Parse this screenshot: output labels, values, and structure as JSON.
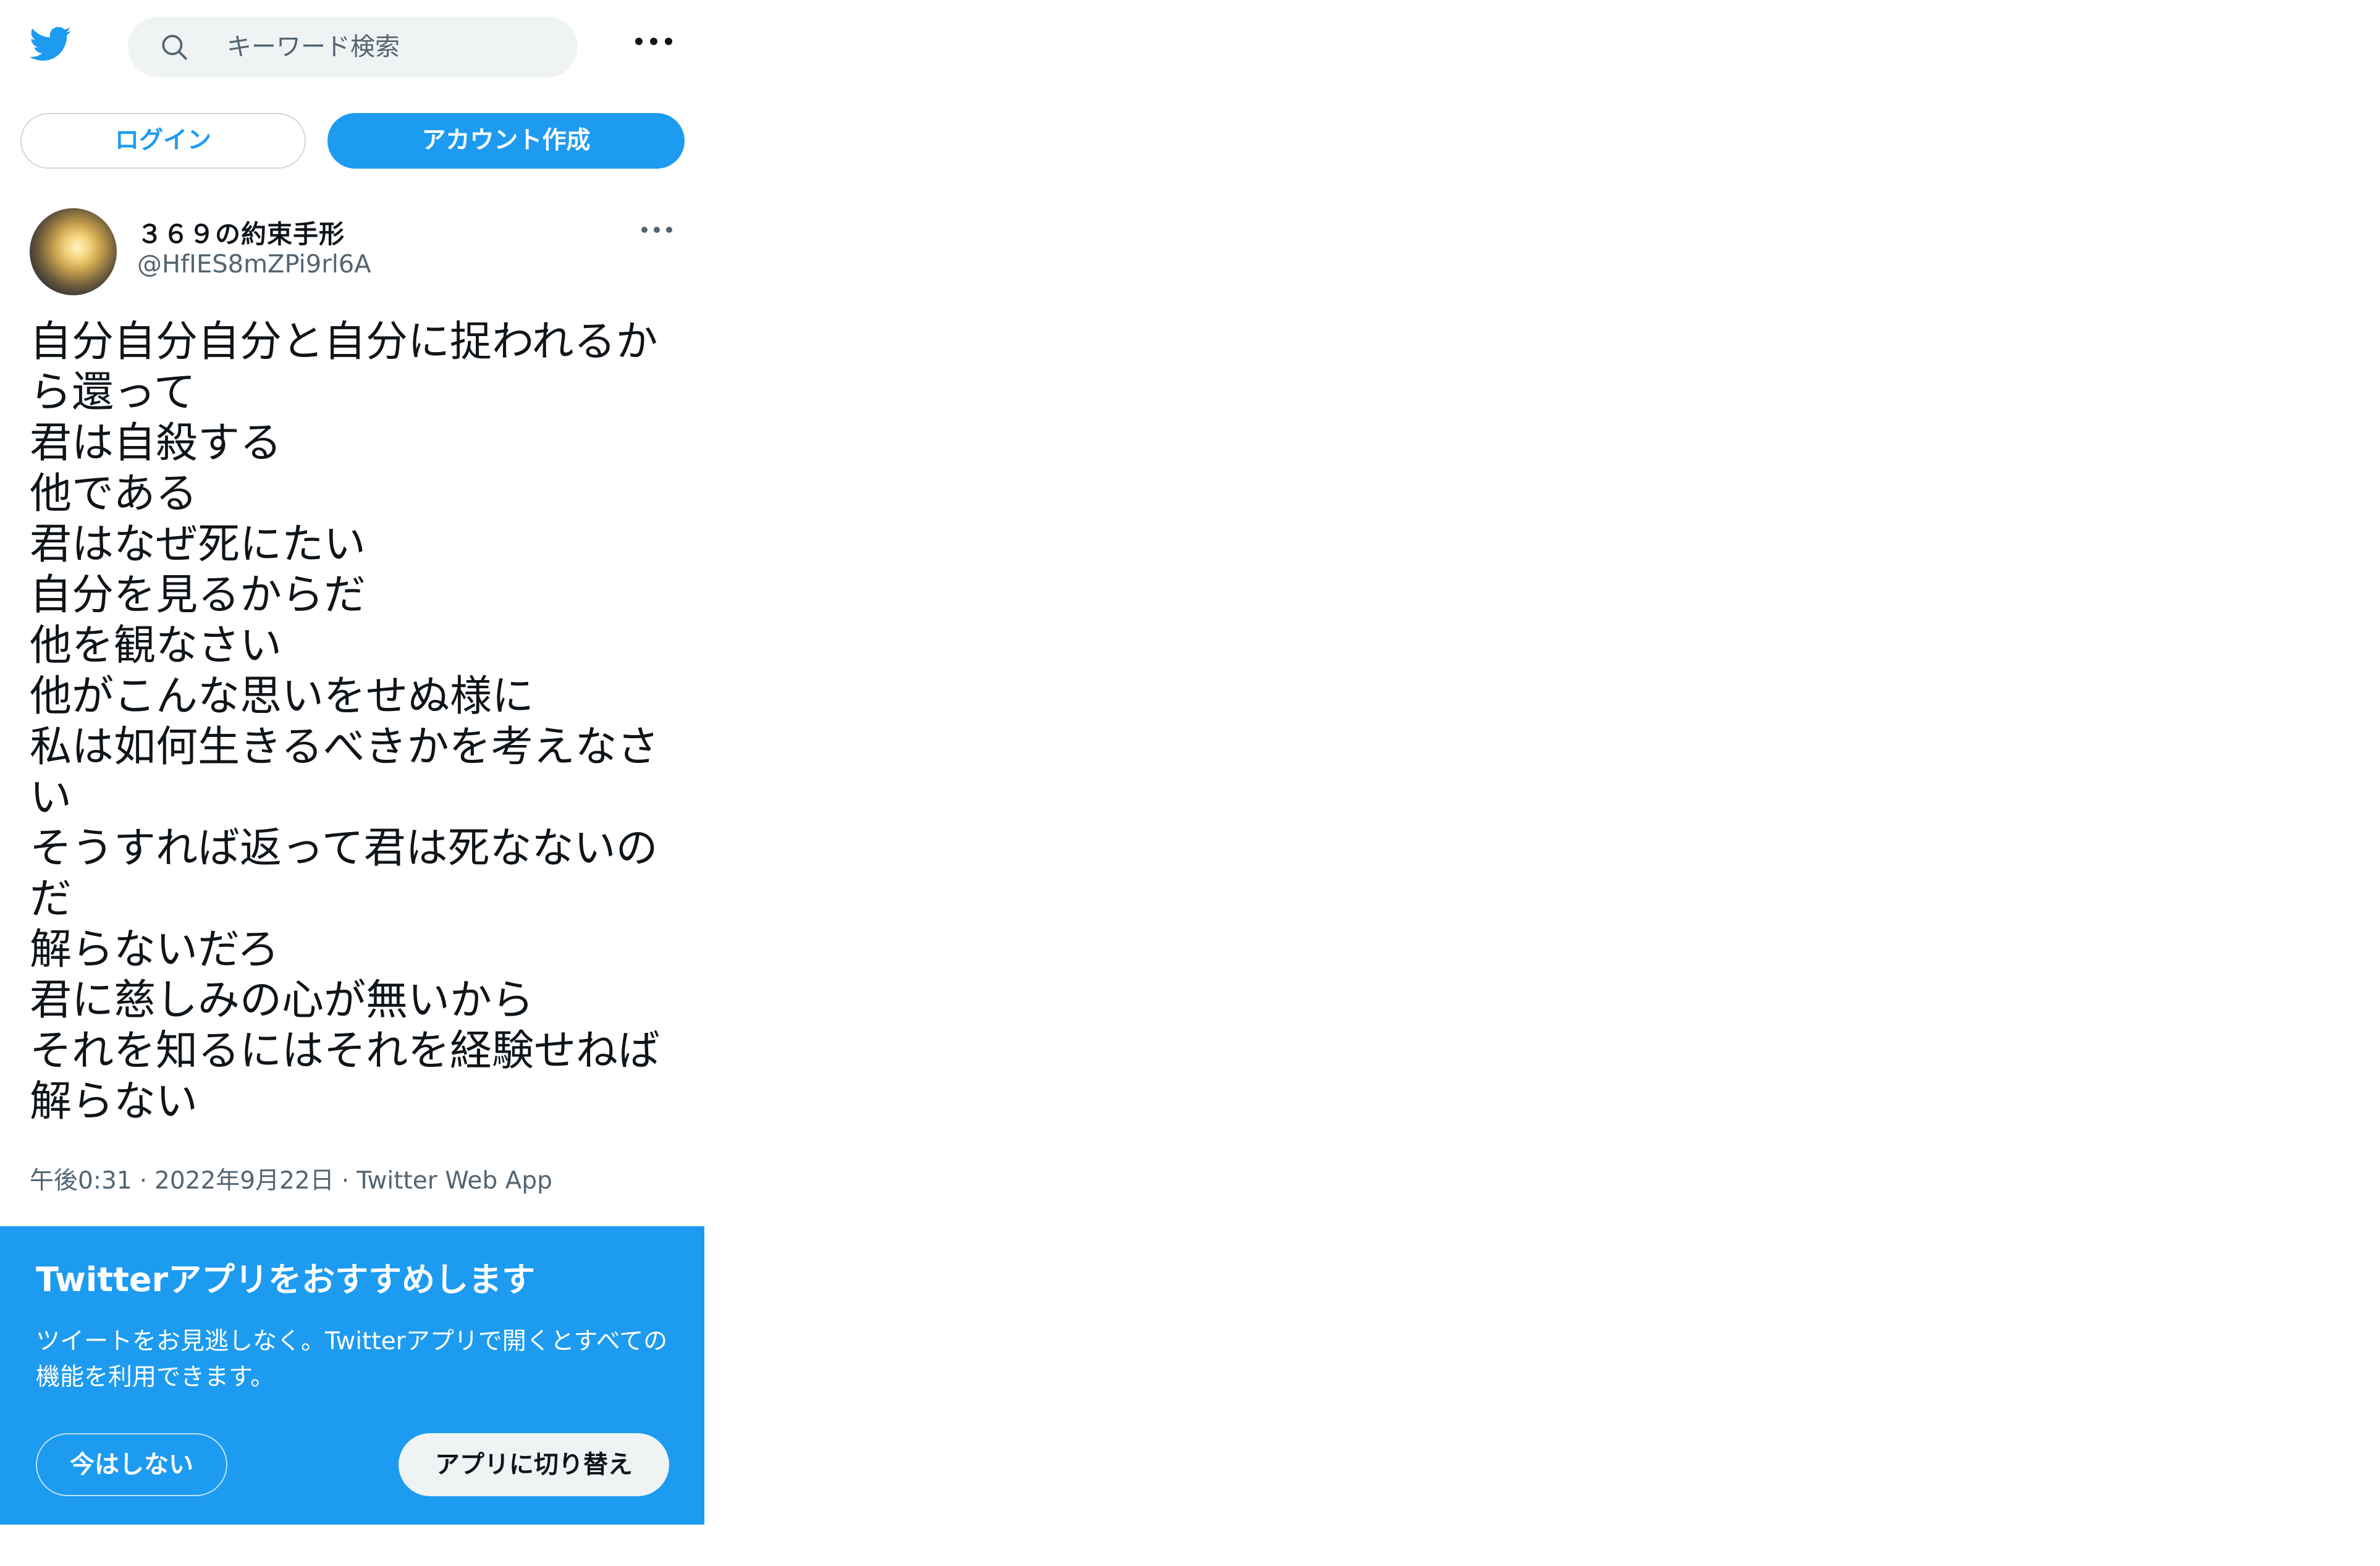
{
  "header": {
    "logo_icon": "twitter-bird-icon",
    "search": {
      "icon": "search-icon",
      "placeholder": "キーワード検索"
    },
    "more_icon": "more-horizontal-icon"
  },
  "auth": {
    "login_label": "ログイン",
    "signup_label": "アカウント作成"
  },
  "tweet": {
    "display_name": "３６９の約束手形",
    "handle": "@HfIES8mZPi9rl6A",
    "more_icon": "more-horizontal-icon",
    "text_lines": [
      "自分自分自分と自分に捉われるか",
      "ら還って",
      "君は自殺する",
      "他である",
      "君はなぜ死にたい",
      "自分を見るからだ",
      "他を観なさい",
      "他がこんな思いをせぬ様に",
      "私は如何生きるべきかを考えなさ",
      "い",
      "そうすれば返って君は死なないの",
      "だ",
      "解らないだろ",
      "君に慈しみの心が無いから",
      "それを知るにはそれを経験せねば",
      "解らない"
    ],
    "time": "午後0:31",
    "date": "2022年9月22日",
    "source": "Twitter Web App",
    "separator": "·"
  },
  "promo": {
    "title": "Twitterアプリをおすすめします",
    "description": "ツイートをお見逃しなく。Twitterアプリで開くとすべての機能を利用できます。",
    "dismiss_label": "今はしない",
    "switch_label": "アプリに切り替え"
  },
  "colors": {
    "brand": "#1d9bf0",
    "text": "#0f1419",
    "secondary": "#536471",
    "search_bg": "#eff3f4"
  }
}
